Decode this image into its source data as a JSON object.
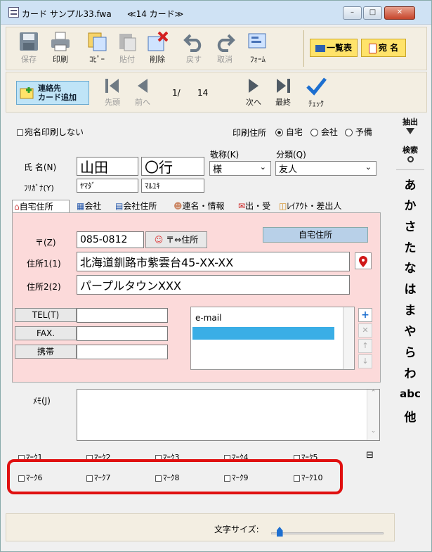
{
  "window": {
    "title": "カード サンプル33.fwa",
    "card_count": "≪14 カード≫"
  },
  "window_buttons": {
    "minimize": "–",
    "maximize": "□",
    "close": "✕"
  },
  "toolbar1": {
    "save": "保存",
    "print": "印刷",
    "copy": "ｺﾋﾟｰ",
    "paste": "貼付",
    "delete": "削除",
    "undo": "戻す",
    "cancel": "取消",
    "form": "ﾌｫｰﾑ",
    "list_view": "一覧表",
    "addressee": "宛 名"
  },
  "toolbar2": {
    "add_contact": "連絡先\nカード追加",
    "first": "先頭",
    "prev": "前へ",
    "next": "次へ",
    "last": "最終",
    "check": "ﾁｪｯｸ",
    "page_current": "1/",
    "page_total": "14"
  },
  "sidebar": {
    "extract": "抽出",
    "search": "検索",
    "kana": [
      "あ",
      "か",
      "さ",
      "た",
      "な",
      "は",
      "ま",
      "や",
      "ら",
      "わ",
      "abc",
      "他"
    ]
  },
  "header": {
    "no_print_label": "宛名印刷しない",
    "print_address_label": "印刷住所",
    "print_options": [
      "自宅",
      "会社",
      "予備"
    ]
  },
  "name": {
    "label": "氏 名(N)",
    "last": "山田",
    "first": "〇行",
    "furigana_label": "ﾌﾘｶﾞﾅ(Y)",
    "kana_last": "ﾔﾏﾀﾞ",
    "kana_first": "ﾏﾙﾕｷ",
    "honorific_label": "敬称(K)",
    "honorific_value": "様",
    "category_label": "分類(Q)",
    "category_value": "友人"
  },
  "tabs": [
    "自宅住所",
    "会社",
    "会社住所",
    "連名・情報",
    "出・受",
    "ﾚｲｱｳﾄ・差出人"
  ],
  "address": {
    "zip_label": "〒(Z)",
    "zip_value": "085-0812",
    "zip_convert": "〒⇔住所",
    "home_badge": "自宅住所",
    "addr1_label": "住所1(1)",
    "addr1_value": "北海道釧路市紫雲台45-XX-XX",
    "addr2_label": "住所2(2)",
    "addr2_value": "パープルタウンXXX"
  },
  "contact": {
    "tel_label": "TEL(T)",
    "fax_label": "FAX.",
    "mobile_label": "携帯",
    "email_header": "e-mail",
    "list_buttons": [
      "+",
      "✕",
      "↑",
      "↓"
    ]
  },
  "memo": {
    "label": "ﾒﾓ(J)",
    "value": ""
  },
  "marks_row1": [
    "ﾏｰｸ1",
    "ﾏｰｸ2",
    "ﾏｰｸ3",
    "ﾏｰｸ4",
    "ﾏｰｸ5"
  ],
  "marks_row2": [
    "ﾏｰｸ6",
    "ﾏｰｸ7",
    "ﾏｰｸ8",
    "ﾏｰｸ9",
    "ﾏｰｸ10"
  ],
  "marks_toggle": "⊟",
  "font_size_label": "文字サイズ:",
  "font_size_level": 0.05,
  "colors": {
    "highlight_box": "#e01010",
    "pink_panel": "#fcdada",
    "accent": "#2aa7e0"
  }
}
